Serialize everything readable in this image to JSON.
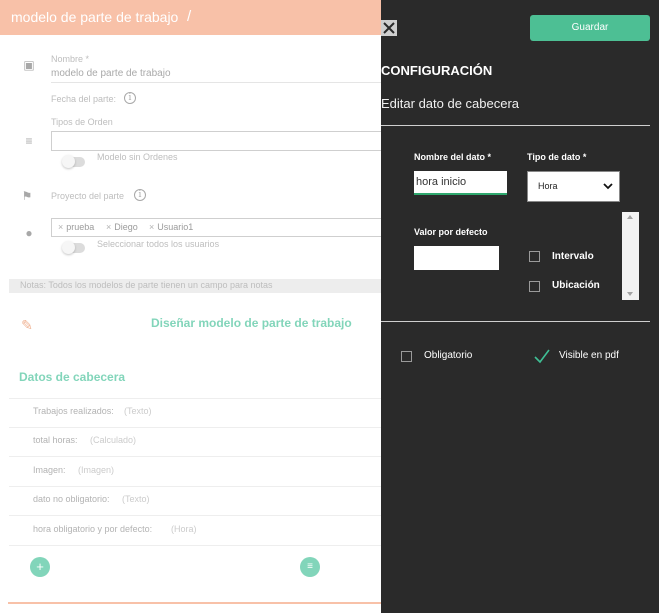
{
  "form": {
    "header_title": "modelo de parte de trabajo",
    "header_slash": "/",
    "nombre_label": "Nombre *",
    "nombre_value": "modelo de parte de trabajo",
    "fecha_label": "Fecha del parte:",
    "tipos_label": "Tipos de Orden",
    "modelo_sin_ordenes": "Modelo sin Ordenes",
    "proyecto_label": "Proyecto del parte",
    "users": [
      "prueba",
      "Diego",
      "Usuario1"
    ],
    "seleccionar_todos": "Seleccionar todos los usuarios",
    "notes": "Notas: Todos los modelos de parte tienen un campo para notas",
    "design_link": "Diseñar modelo de parte de trabajo",
    "datos_title": "Datos de cabecera",
    "fields": [
      {
        "name": "Trabajos realizados:",
        "type": "(Texto)"
      },
      {
        "name": "total horas:",
        "type": "(Calculado)"
      },
      {
        "name": "Imagen:",
        "type": "(Imagen)"
      },
      {
        "name": "dato no obligatorio:",
        "type": "(Texto)"
      },
      {
        "name": "hora obligatorio y por defecto:",
        "type": "(Hora)"
      }
    ],
    "add_icon": "plus-icon",
    "list_icon": "list-icon"
  },
  "panel": {
    "save_label": "Guardar",
    "config_title": "CONFIGURACIÓN",
    "edit_title": "Editar dato de cabecera",
    "nombre_dato_label": "Nombre del dato *",
    "nombre_dato_value": "hora inicio",
    "tipo_dato_label": "Tipo de dato *",
    "tipo_dato_value": "Hora",
    "valor_defecto_label": "Valor por defecto",
    "valor_defecto_value": "",
    "intervalo_label": "Intervalo",
    "ubicacion_label": "Ubicación",
    "obligatorio_label": "Obligatorio",
    "visible_pdf_label": "Visible en pdf",
    "visible_pdf_checked": true,
    "intervalo_checked": false,
    "ubicacion_checked": false,
    "obligatorio_checked": false,
    "accent_color": "#4dbf94",
    "header_color": "#f5a07a"
  }
}
